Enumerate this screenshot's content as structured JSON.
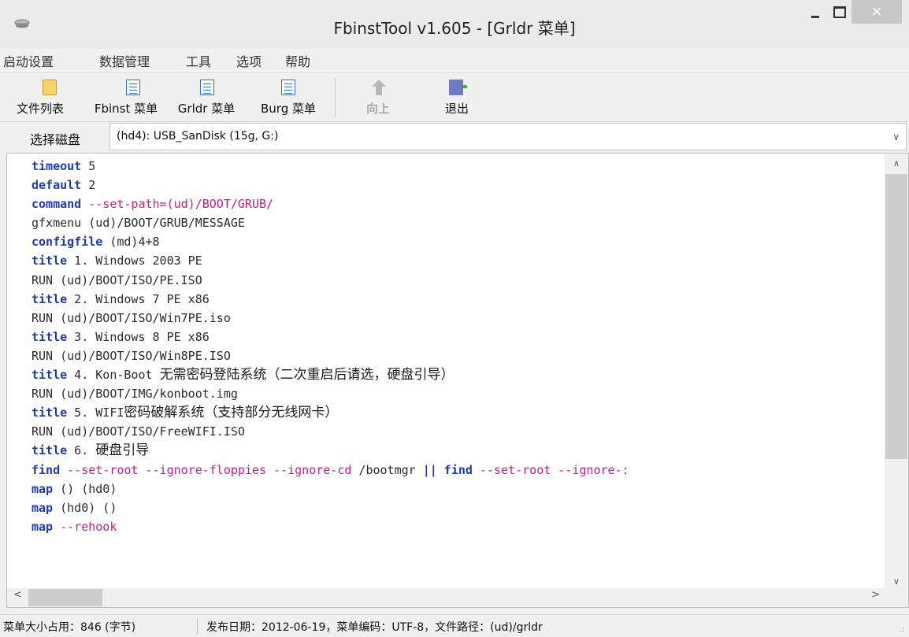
{
  "window": {
    "title": "FbinstTool v1.605 - [Grldr 菜单]",
    "close_glyph": "×"
  },
  "menu": [
    "启动设置",
    "数据管理",
    "工具",
    "选项",
    "帮助"
  ],
  "toolbar": {
    "file_list": "文件列表",
    "fbinst_menu": "Fbinst 菜单",
    "grldr_menu": "Grldr 菜单",
    "burg_menu": "Burg 菜单",
    "up": "向上",
    "exit": "退出"
  },
  "disk": {
    "label": "选择磁盘",
    "value": "(hd4): USB_SanDisk (15g, G:)"
  },
  "code": [
    [
      {
        "t": "timeout",
        "c": "kw"
      },
      {
        "t": " 5",
        "c": ""
      }
    ],
    [
      {
        "t": "default",
        "c": "kw"
      },
      {
        "t": " 2",
        "c": ""
      }
    ],
    [
      {
        "t": "command",
        "c": "kw"
      },
      {
        "t": " --set-path=(ud)/BOOT/GRUB/",
        "c": "pk"
      }
    ],
    [
      {
        "t": "gfxmenu (ud)/BOOT/GRUB/MESSAGE",
        "c": ""
      }
    ],
    [
      {
        "t": "configfile",
        "c": "kw"
      },
      {
        "t": " (md)4+8",
        "c": ""
      }
    ],
    [
      {
        "t": "title",
        "c": "kw"
      },
      {
        "t": " 1. Windows 2003 PE",
        "c": ""
      }
    ],
    [
      {
        "t": "RUN (ud)/BOOT/ISO/PE.ISO",
        "c": ""
      }
    ],
    [
      {
        "t": "title",
        "c": "kw"
      },
      {
        "t": " 2. Windows 7 PE x86",
        "c": ""
      }
    ],
    [
      {
        "t": "RUN (ud)/BOOT/ISO/Win7PE.iso",
        "c": ""
      }
    ],
    [
      {
        "t": "title",
        "c": "kw"
      },
      {
        "t": " 3. Windows 8 PE x86",
        "c": ""
      }
    ],
    [
      {
        "t": "RUN (ud)/BOOT/ISO/Win8PE.ISO",
        "c": ""
      }
    ],
    [
      {
        "t": "title",
        "c": "kw"
      },
      {
        "t": " 4. Kon-Boot ",
        "c": ""
      },
      {
        "t": "无需密码登陆系统（二次重启后请选，硬盘引导）",
        "c": "cjk"
      }
    ],
    [
      {
        "t": "RUN (ud)/BOOT/IMG/konboot.img",
        "c": ""
      }
    ],
    [
      {
        "t": "title",
        "c": "kw"
      },
      {
        "t": " 5. WIFI",
        "c": ""
      },
      {
        "t": "密码破解系统（支持部分无线网卡）",
        "c": "cjk"
      }
    ],
    [
      {
        "t": "RUN (ud)/BOOT/ISO/FreeWIFI.ISO",
        "c": ""
      }
    ],
    [
      {
        "t": "title",
        "c": "kw"
      },
      {
        "t": " 6. ",
        "c": ""
      },
      {
        "t": "硬盘引导",
        "c": "cjk"
      }
    ],
    [
      {
        "t": "find",
        "c": "kw"
      },
      {
        "t": " --set-root --ignore-floppies --ignore-cd ",
        "c": "pk"
      },
      {
        "t": "/bootmgr ",
        "c": ""
      },
      {
        "t": "||",
        "c": "kw"
      },
      {
        "t": " ",
        "c": ""
      },
      {
        "t": "find",
        "c": "kw"
      },
      {
        "t": " --set-root --ignore-:",
        "c": "pk"
      }
    ],
    [
      {
        "t": "map",
        "c": "kw"
      },
      {
        "t": " () (hd0)",
        "c": ""
      }
    ],
    [
      {
        "t": "map",
        "c": "kw"
      },
      {
        "t": " (hd0) ()",
        "c": ""
      }
    ],
    [
      {
        "t": "map",
        "c": "kw"
      },
      {
        "t": " --rehook",
        "c": "pk"
      }
    ]
  ],
  "scroll": {
    "up": "∧",
    "down": "∨",
    "left": "<",
    "right": ">"
  },
  "status": {
    "size": "菜单大小占用：846 (字节)",
    "info": "发布日期：2012-06-19，菜单编码：UTF-8，文件路径：(ud)/grldr"
  },
  "colors": {
    "keyword": "#1e3ca8",
    "option": "#c0208c",
    "text": "#2b2b2b"
  }
}
